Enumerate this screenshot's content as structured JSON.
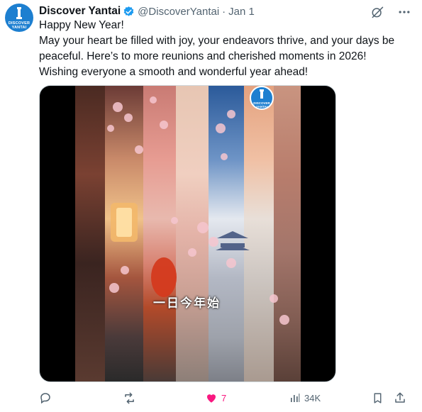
{
  "tweet": {
    "display_name": "Discover Yantai",
    "handle": "@DiscoverYantai",
    "separator": "·",
    "date": "Jan 1",
    "avatar_text": [
      "DISCOVER",
      "YANTAI"
    ],
    "text_lines": [
      "Happy New Year!",
      "May your heart be filled with joy, your endeavors thrive, and your days be",
      "peaceful. Here’s to more reunions and cherished moments in 2026!",
      "Wishing everyone a smooth and wonderful year ahead!"
    ],
    "media": {
      "logo_text": [
        "DISCOVER",
        "YANTAI"
      ],
      "caption": "一日今年始"
    },
    "actions": {
      "reply": {
        "icon": "reply-icon",
        "count": ""
      },
      "retweet": {
        "icon": "retweet-icon",
        "count": ""
      },
      "like": {
        "icon": "heart-icon",
        "count": "7",
        "liked": true
      },
      "views": {
        "icon": "views-icon",
        "count": "34K"
      },
      "bookmark": {
        "icon": "bookmark-icon"
      },
      "share": {
        "icon": "share-icon"
      }
    },
    "top_icons": [
      "grok-icon",
      "more-icon"
    ]
  },
  "colors": {
    "accent": "#1d9bf0",
    "like": "#f91880",
    "secondary_text": "#536471"
  }
}
